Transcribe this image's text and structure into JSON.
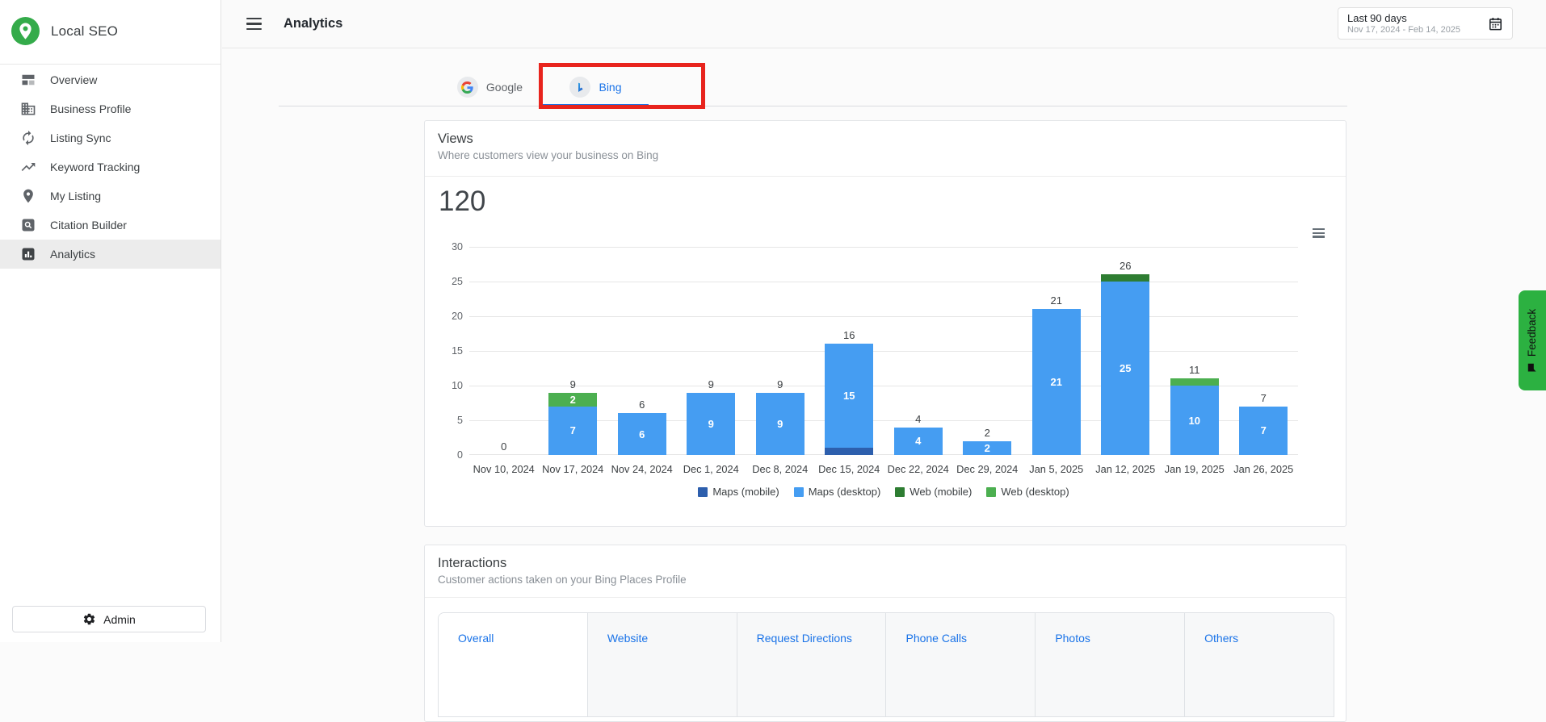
{
  "sidebar": {
    "brand": "Local SEO",
    "brand_color": "#34ab4a",
    "items": [
      {
        "label": "Overview",
        "icon": "overview",
        "active": false
      },
      {
        "label": "Business Profile",
        "icon": "business-profile",
        "active": false
      },
      {
        "label": "Listing Sync",
        "icon": "listing-sync",
        "active": false
      },
      {
        "label": "Keyword Tracking",
        "icon": "keyword-tracking",
        "active": false
      },
      {
        "label": "My Listing",
        "icon": "my-listing",
        "active": false
      },
      {
        "label": "Citation Builder",
        "icon": "citation-builder",
        "active": false
      },
      {
        "label": "Analytics",
        "icon": "analytics",
        "active": true
      }
    ],
    "admin_label": "Admin"
  },
  "header": {
    "title": "Analytics",
    "date_range": {
      "label": "Last 90 days",
      "range": "Nov 17, 2024 - Feb 14, 2025"
    }
  },
  "platform_tabs": [
    {
      "label": "Google",
      "active": false
    },
    {
      "label": "Bing",
      "active": true
    }
  ],
  "annotation": {
    "highlight_color": "#e8241d",
    "highlighted_tab": "Bing"
  },
  "views_card": {
    "title": "Views",
    "subtitle": "Where customers view your business on Bing",
    "total": "120"
  },
  "chart_data": {
    "type": "bar",
    "stacked": true,
    "title": "",
    "xlabel": "",
    "ylabel": "",
    "ylim": [
      0,
      30
    ],
    "yticks": [
      0,
      5,
      10,
      15,
      20,
      25,
      30
    ],
    "grid": true,
    "legend_position": "bottom",
    "categories": [
      "Nov 10, 2024",
      "Nov 17, 2024",
      "Nov 24, 2024",
      "Dec 1, 2024",
      "Dec 8, 2024",
      "Dec 15, 2024",
      "Dec 22, 2024",
      "Dec 29, 2024",
      "Jan 5, 2025",
      "Jan 12, 2025",
      "Jan 19, 2025",
      "Jan 26, 2025"
    ],
    "series": [
      {
        "name": "Maps (mobile)",
        "color": "#2d5fad",
        "values": [
          0,
          0,
          0,
          0,
          0,
          1,
          0,
          0,
          0,
          0,
          0,
          0
        ]
      },
      {
        "name": "Maps (desktop)",
        "color": "#459df2",
        "values": [
          0,
          7,
          6,
          9,
          9,
          15,
          4,
          2,
          21,
          25,
          10,
          7
        ]
      },
      {
        "name": "Web (mobile)",
        "color": "#2e7d32",
        "values": [
          0,
          0,
          0,
          0,
          0,
          0,
          0,
          0,
          0,
          1,
          0,
          0
        ]
      },
      {
        "name": "Web (desktop)",
        "color": "#4caf50",
        "values": [
          0,
          2,
          0,
          0,
          0,
          0,
          0,
          0,
          0,
          0,
          1,
          0
        ]
      }
    ],
    "totals": [
      0,
      9,
      6,
      9,
      9,
      16,
      4,
      2,
      21,
      26,
      11,
      7
    ],
    "segment_label_min_value": 2
  },
  "interactions_card": {
    "title": "Interactions",
    "subtitle": "Customer actions taken on your Bing Places Profile",
    "tabs": [
      {
        "label": "Overall",
        "active": true
      },
      {
        "label": "Website",
        "active": false
      },
      {
        "label": "Request Directions",
        "active": false
      },
      {
        "label": "Phone Calls",
        "active": false
      },
      {
        "label": "Photos",
        "active": false
      },
      {
        "label": "Others",
        "active": false
      }
    ]
  },
  "feedback": {
    "label": "Feedback",
    "color": "#2cb141"
  }
}
